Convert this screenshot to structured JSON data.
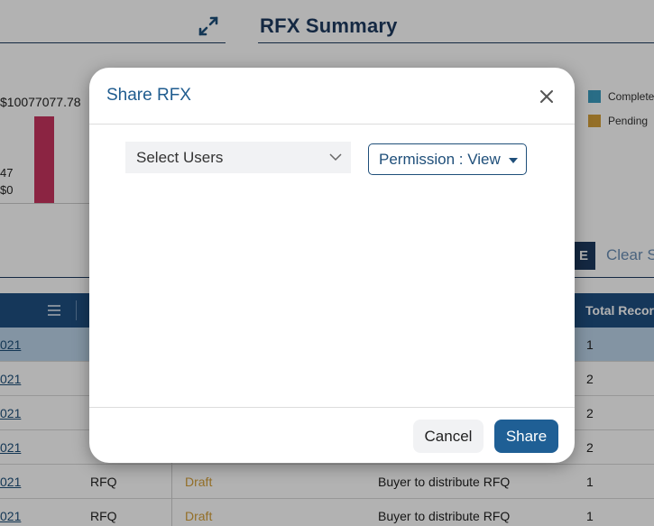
{
  "page": {
    "title": "RFX Summary"
  },
  "chart": {
    "top_value": "$10077077.78",
    "mid_value": "47",
    "zero_value": "$0"
  },
  "legend": [
    {
      "label": "Complete",
      "color": "#3b9dc0"
    },
    {
      "label": "Pending",
      "color": "#d4a03a"
    }
  ],
  "filters": {
    "apply_label_partial": "E",
    "clear_label": "Clear S"
  },
  "table": {
    "header_total": "Total Recor",
    "rows": [
      {
        "date": "021",
        "type": "",
        "status": "",
        "description": "",
        "total": "1",
        "selected": true
      },
      {
        "date": "021",
        "type": "",
        "status": "",
        "description": "",
        "total": "2"
      },
      {
        "date": "021",
        "type": "",
        "status": "",
        "description": "",
        "total": "2"
      },
      {
        "date": "021",
        "type": "",
        "status": "",
        "description": "",
        "total": "2"
      },
      {
        "date": "021",
        "type": "RFQ",
        "status": "Draft",
        "description": "Buyer to distribute RFQ",
        "total": "1"
      },
      {
        "date": "021",
        "type": "RFQ",
        "status": "Draft",
        "description": "Buyer to distribute RFQ",
        "total": "1"
      }
    ]
  },
  "modal": {
    "title": "Share RFX",
    "select_users_placeholder": "Select Users",
    "permission_label": "Permission : View",
    "cancel_label": "Cancel",
    "share_label": "Share"
  },
  "colors": {
    "primary": "#1f5f95",
    "header_blue": "#1f4f82",
    "bar_pink": "#c8345f",
    "draft_amber": "#d4a03a"
  }
}
